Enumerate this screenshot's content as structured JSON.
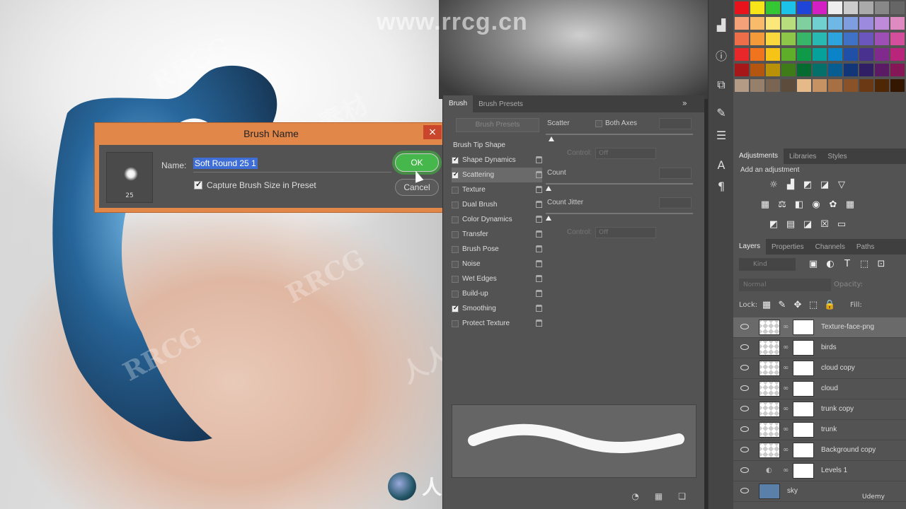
{
  "watermarks": {
    "site": "www.rrcg.cn",
    "brand": "RRCG",
    "brand_cn": "人人素材",
    "bottom_logo_text": "人人素材"
  },
  "brush_name_dialog": {
    "title": "Brush Name",
    "close_glyph": "×",
    "name_label": "Name:",
    "name_value": "Soft Round 25 1",
    "brush_size": "25",
    "capture_label": "Capture Brush Size in Preset",
    "capture_checked": true,
    "ok_label": "OK",
    "cancel_label": "Cancel"
  },
  "brush_panel": {
    "tabs": [
      "Brush",
      "Brush Presets"
    ],
    "active_tab": "Brush",
    "menu_glyph": "»",
    "presets_button": "Brush Presets",
    "options": [
      {
        "label": "Brush Tip Shape",
        "checkbox": false,
        "checked": false,
        "lock": false
      },
      {
        "label": "Shape Dynamics",
        "checkbox": true,
        "checked": true,
        "lock": true
      },
      {
        "label": "Scattering",
        "checkbox": true,
        "checked": true,
        "lock": true
      },
      {
        "label": "Texture",
        "checkbox": true,
        "checked": false,
        "lock": true
      },
      {
        "label": "Dual Brush",
        "checkbox": true,
        "checked": false,
        "lock": true
      },
      {
        "label": "Color Dynamics",
        "checkbox": true,
        "checked": false,
        "lock": true
      },
      {
        "label": "Transfer",
        "checkbox": true,
        "checked": false,
        "lock": true
      },
      {
        "label": "Brush Pose",
        "checkbox": true,
        "checked": false,
        "lock": true
      },
      {
        "label": "Noise",
        "checkbox": true,
        "checked": false,
        "lock": true
      },
      {
        "label": "Wet Edges",
        "checkbox": true,
        "checked": false,
        "lock": true
      },
      {
        "label": "Build-up",
        "checkbox": true,
        "checked": false,
        "lock": true
      },
      {
        "label": "Smoothing",
        "checkbox": true,
        "checked": true,
        "lock": true
      },
      {
        "label": "Protect Texture",
        "checkbox": true,
        "checked": false,
        "lock": true
      }
    ],
    "settings": {
      "scatter_label": "Scatter",
      "both_axes_label": "Both Axes",
      "control_label": "Control:",
      "control_value": "Off",
      "count_label": "Count",
      "count_jitter_label": "Count Jitter",
      "control2_label": "Control:",
      "control2_value": "Off"
    }
  },
  "tools": {
    "icons": [
      "histogram-icon",
      "info-icon",
      "clone-source-icon",
      "brush-icon",
      "sliders-icon",
      "character-icon",
      "paragraph-icon"
    ]
  },
  "adjustments": {
    "tabs": [
      "Adjustments",
      "Libraries",
      "Styles"
    ],
    "active_tab": "Adjustments",
    "heading": "Add an adjustment"
  },
  "layers_panel": {
    "tabs": [
      "Layers",
      "Properties",
      "Channels",
      "Paths"
    ],
    "active_tab": "Layers",
    "filter_placeholder": "Kind",
    "blend_mode": "Normal",
    "opacity_label": "Opacity:",
    "lock_label": "Lock:",
    "fill_label": "Fill:",
    "layers": [
      {
        "name": "Texture-face-png",
        "selected": true
      },
      {
        "name": "birds",
        "selected": false
      },
      {
        "name": "cloud copy",
        "selected": false
      },
      {
        "name": "cloud",
        "selected": false
      },
      {
        "name": "trunk copy",
        "selected": false
      },
      {
        "name": "trunk",
        "selected": false
      },
      {
        "name": "Background copy",
        "selected": false
      },
      {
        "name": "Levels 1",
        "selected": false
      },
      {
        "name": "sky",
        "selected": false
      }
    ]
  },
  "footer": {
    "udemy": "Udemy"
  }
}
